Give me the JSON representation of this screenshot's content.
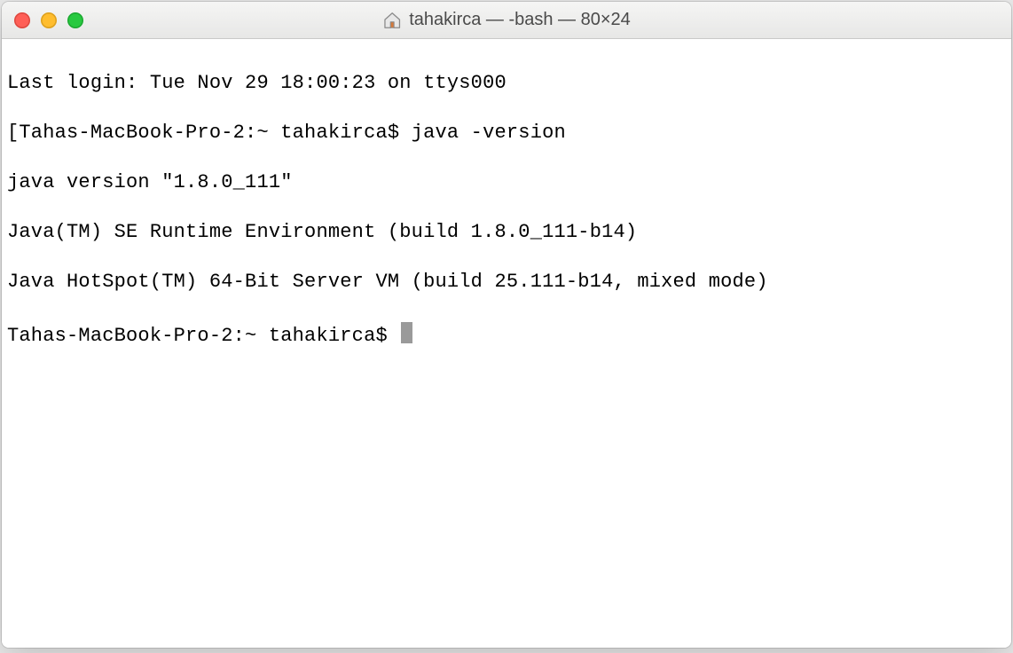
{
  "titlebar": {
    "title": "tahakirca — -bash — 80×24"
  },
  "terminal": {
    "lines": [
      "Last login: Tue Nov 29 18:00:23 on ttys000",
      "[Tahas-MacBook-Pro-2:~ tahakirca$ java -version",
      "java version \"1.8.0_111\"",
      "Java(TM) SE Runtime Environment (build 1.8.0_111-b14)",
      "Java HotSpot(TM) 64-Bit Server VM (build 25.111-b14, mixed mode)"
    ],
    "prompt": "Tahas-MacBook-Pro-2:~ tahakirca$ "
  }
}
